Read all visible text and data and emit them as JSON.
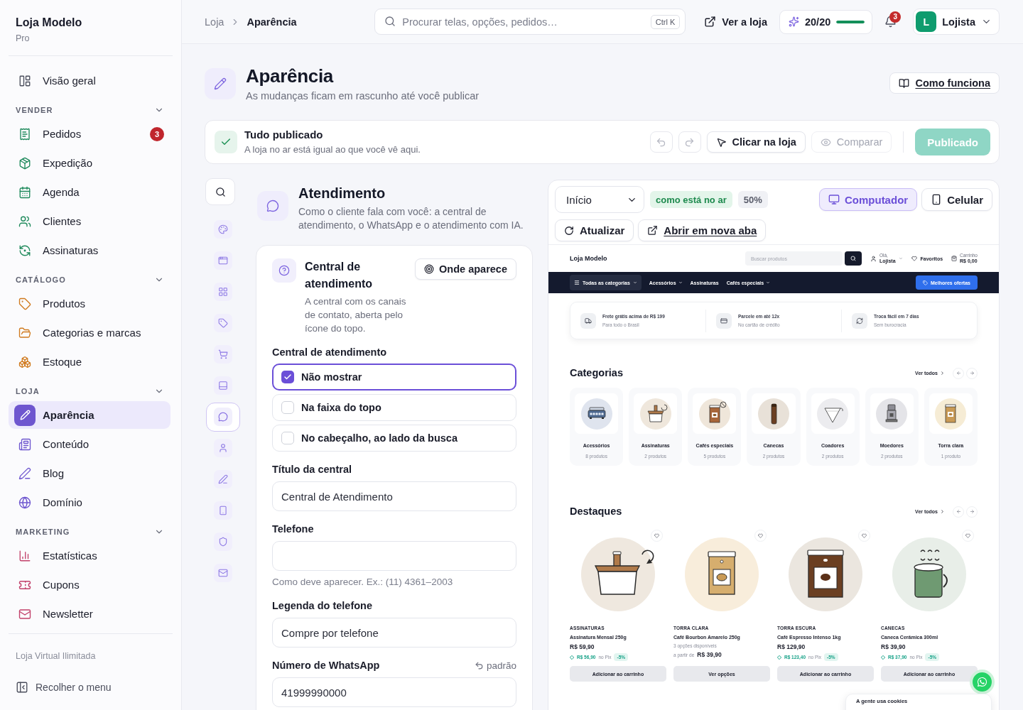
{
  "sidebar": {
    "brand": "Loja Modelo",
    "plan": "Pro",
    "items": [
      {
        "label": "Visão geral",
        "selected": false
      }
    ],
    "sections": [
      {
        "title": "VENDER",
        "expanded": true,
        "items": [
          {
            "label": "Pedidos",
            "badge": "3",
            "selected": false
          },
          {
            "label": "Expedição",
            "selected": false
          },
          {
            "label": "Agenda",
            "selected": false
          },
          {
            "label": "Clientes",
            "selected": false
          },
          {
            "label": "Assinaturas",
            "selected": false
          }
        ]
      },
      {
        "title": "CATÁLOGO",
        "expanded": true,
        "items": [
          {
            "label": "Produtos",
            "selected": false
          },
          {
            "label": "Categorias e marcas",
            "selected": false
          },
          {
            "label": "Estoque",
            "selected": false
          }
        ]
      },
      {
        "title": "LOJA",
        "expanded": true,
        "items": [
          {
            "label": "Aparência",
            "selected": true
          },
          {
            "label": "Conteúdo",
            "selected": false
          },
          {
            "label": "Blog",
            "selected": false
          },
          {
            "label": "Domínio",
            "selected": false
          }
        ]
      },
      {
        "title": "MARKETING",
        "expanded": true,
        "items": [
          {
            "label": "Estatísticas",
            "selected": false
          },
          {
            "label": "Cupons",
            "selected": false
          },
          {
            "label": "Newsletter",
            "selected": false
          }
        ]
      }
    ],
    "plan_note": "Loja Virtual Ilimitada",
    "collapse": "Recolher o menu"
  },
  "topbar": {
    "breadcrumb": [
      "Loja",
      "Aparência"
    ],
    "search": {
      "placeholder": "Procurar telas, opções, pedidos…",
      "shortcut": "Ctrl K"
    },
    "view_store": "Ver a loja",
    "credits": {
      "label": "20/20",
      "level": 1
    },
    "notifications": "3",
    "user": {
      "initial": "L",
      "name": "Lojista"
    }
  },
  "page": {
    "title": "Aparência",
    "subtitle": "As mudanças ficam em rascunho até você publicar",
    "help": "Como funciona"
  },
  "publish_bar": {
    "title": "Tudo publicado",
    "text": "A loja no ar está igual ao que você vê aqui.",
    "undo": {
      "disabled": true
    },
    "redo": {
      "disabled": true
    },
    "actions": [
      {
        "label": "Clicar na loja",
        "disabled": false
      },
      {
        "label": "Comparar",
        "disabled": true
      }
    ],
    "publish": {
      "label": "Publicado",
      "disabled": true
    }
  },
  "rail": {
    "items": [
      {
        "selected": false
      },
      {
        "selected": false
      },
      {
        "selected": false
      },
      {
        "selected": false
      },
      {
        "selected": false
      },
      {
        "selected": false
      },
      {
        "selected": true
      },
      {
        "selected": false
      },
      {
        "selected": false
      },
      {
        "selected": false
      },
      {
        "selected": false
      },
      {
        "selected": false
      }
    ]
  },
  "section": {
    "title": "Atendimento",
    "description": "Como o cliente fala com você: a central de atendimento, o WhatsApp e o atendimento com IA.",
    "card": {
      "title": "Central de atendimento",
      "description": "A central com os canais de contato, aberta pelo ícone do topo.",
      "where": "Onde aparece",
      "fields": [
        {
          "kind": "choice",
          "label": "Central de atendimento",
          "options": [
            {
              "label": "Não mostrar",
              "selected": true
            },
            {
              "label": "Na faixa do topo",
              "selected": false
            },
            {
              "label": "No cabeçalho, ao lado da busca",
              "selected": false
            }
          ]
        },
        {
          "kind": "text",
          "label": "Título da central",
          "value": "Central de Atendimento"
        },
        {
          "kind": "text",
          "label": "Telefone",
          "help": "Como deve aparecer. Ex.: (11) 4361–2003"
        },
        {
          "kind": "text",
          "label": "Legenda do telefone",
          "value": "Compre por telefone"
        },
        {
          "kind": "text",
          "label": "Número de WhatsApp",
          "reset": "padrão",
          "value": "41999990000"
        }
      ]
    }
  },
  "preview": {
    "page_select": "Início",
    "status": "como está no ar",
    "zoom": "50%",
    "devices": [
      {
        "label": "Computador",
        "selected": true
      },
      {
        "label": "Celular",
        "selected": false
      }
    ],
    "refresh": "Atualizar",
    "open_tab": "Abrir em nova aba",
    "store": {
      "name": "Loja Modelo",
      "search_placeholder": "Buscar produtos",
      "greeting": "Olá,",
      "account": "Lojista",
      "favorites": "Favoritos",
      "cart_label": "Carrinho",
      "cart_total": "R$ 0,00",
      "nav": [
        {
          "kind": "all",
          "label": "Todas as categorias",
          "dropdown": true
        },
        {
          "kind": "link",
          "label": "Acessórios",
          "dropdown": true
        },
        {
          "kind": "link",
          "label": "Assinaturas",
          "dropdown": false
        },
        {
          "kind": "link",
          "label": "Cafés especiais",
          "dropdown": true
        }
      ],
      "offers": "Melhores ofertas",
      "benefits": [
        {
          "title": "Frete grátis acima de R$ 199",
          "subtitle": "Para todo o Brasil"
        },
        {
          "title": "Parcele em até 12x",
          "subtitle": "No cartão de crédito"
        },
        {
          "title": "Troca fácil em 7 dias",
          "subtitle": "Sem burocracia"
        }
      ],
      "categories": {
        "title": "Categorias",
        "see_all": "Ver todos",
        "items": [
          {
            "name": "Acessórios",
            "count": "8 produtos"
          },
          {
            "name": "Assinaturas",
            "count": "2 produtos"
          },
          {
            "name": "Cafés especiais",
            "count": "5 produtos"
          },
          {
            "name": "Canecas",
            "count": "2 produtos"
          },
          {
            "name": "Coadores",
            "count": "2 produtos"
          },
          {
            "name": "Moedores",
            "count": "2 produtos"
          },
          {
            "name": "Torra clara",
            "count": "1 produto"
          }
        ]
      },
      "featured": {
        "title": "Destaques",
        "see_all": "Ver todos",
        "products": [
          {
            "kind": "simple",
            "category": "ASSINATURAS",
            "name": "Assinatura Mensal 250g",
            "price": "R$ 59,90",
            "pix_price": "R$ 56,90",
            "pix_label": "no Pix",
            "discount": "-5%",
            "button": "Adicionar ao carrinho"
          },
          {
            "kind": "variants",
            "category": "TORRA CLARA",
            "name": "Café Bourbon Amarelo 250g",
            "options": "3 opções disponíveis",
            "from_label": "a partir de",
            "price": "R$ 39,90",
            "button": "Ver opções"
          },
          {
            "kind": "simple",
            "category": "TORRA ESCURA",
            "name": "Café Espresso Intenso 1kg",
            "price": "R$ 129,90",
            "pix_price": "R$ 123,40",
            "pix_label": "no Pix",
            "discount": "-5%",
            "button": "Adicionar ao carrinho"
          },
          {
            "kind": "simple",
            "category": "CANECAS",
            "name": "Caneca Cerâmica 300ml",
            "price": "R$ 39,90",
            "pix_price": "R$ 37,90",
            "pix_label": "no Pix",
            "discount": "-5%",
            "button": "Adicionar ao carrinho"
          }
        ]
      },
      "cookie_banner": "A gente usa cookies"
    }
  }
}
